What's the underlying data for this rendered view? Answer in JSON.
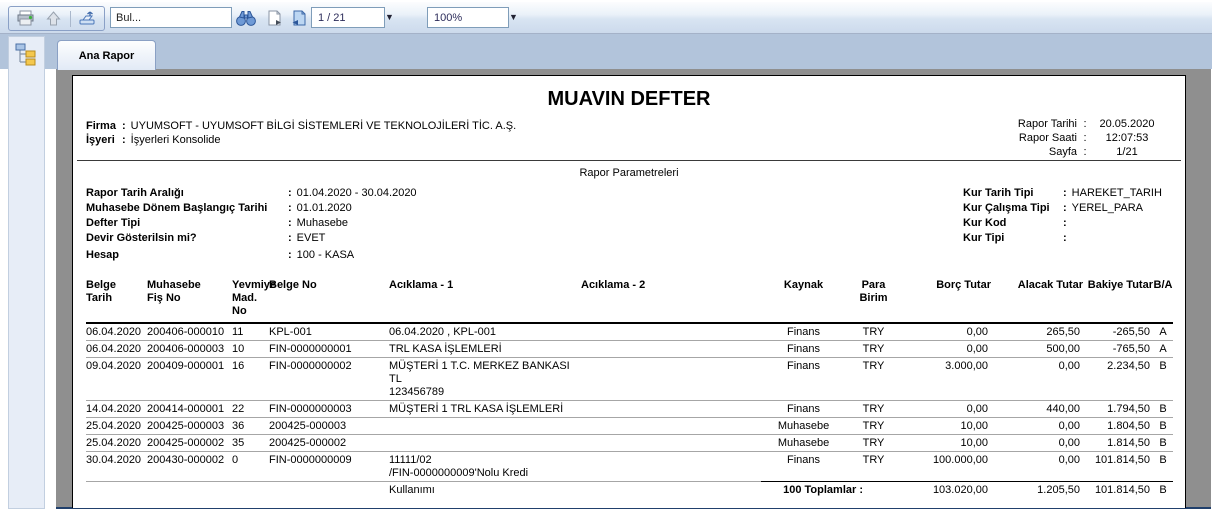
{
  "toolbar": {
    "find_value": "Bul...",
    "page_indicator": "1 / 21",
    "zoom_level": "100%",
    "dropdown_glyph": "▼"
  },
  "tabs": {
    "ana_rapor": "Ana Rapor"
  },
  "report": {
    "title": "MUAVIN DEFTER",
    "company": {
      "label": "Firma",
      "value": "UYUMSOFT - UYUMSOFT BİLGİ SİSTEMLERİ VE TEKNOLOJİLERİ TİC. A.Ş."
    },
    "branch": {
      "label": "İşyeri",
      "value": "İşyerleri Konsolide"
    },
    "info": [
      {
        "label": "Rapor Tarihi",
        "value": "20.05.2020"
      },
      {
        "label": "Rapor Saati",
        "value": "12:07:53"
      },
      {
        "label": "Sayfa",
        "value": "1/21"
      }
    ],
    "parameters_title": "Rapor Parametreleri",
    "parameters_left": [
      {
        "label": "Rapor Tarih Aralığı",
        "value": "01.04.2020 - 30.04.2020"
      },
      {
        "label": "Muhasebe Dönem Başlangıç Tarihi",
        "value": "01.01.2020"
      },
      {
        "label": "Defter Tipi",
        "value": "Muhasebe"
      },
      {
        "label": "Devir Gösterilsin mi?",
        "value": "EVET"
      },
      {
        "label": "Hesap",
        "value": "100 - KASA"
      }
    ],
    "parameters_right": [
      {
        "label": "Kur Tarih Tipi",
        "value": "HAREKET_TARIH"
      },
      {
        "label": "Kur Çalışma Tipi",
        "value": "YEREL_PARA"
      },
      {
        "label": "Kur Kod",
        "value": ""
      },
      {
        "label": "Kur Tipi",
        "value": ""
      }
    ],
    "table": {
      "headers": {
        "tarih": "Belge\nTarih",
        "fis": "Muhasebe\nFiş No",
        "mad": "Yevmiye\nMad. No",
        "belge": "Belge No",
        "a1": "Acıklama - 1",
        "a2": "Acıklama - 2",
        "kaynak": "Kaynak",
        "para": "Para\nBirim",
        "borc": "Borç Tutar",
        "alacak": "Alacak Tutar",
        "bakiye": "Bakiye Tutar",
        "ba": "B/A"
      },
      "rows": [
        {
          "tarih": "06.04.2020",
          "fis": "200406-000010",
          "mad": "11",
          "belge": "KPL-001",
          "a1": "06.04.2020 , KPL-001",
          "a2": "",
          "kaynak": "Finans",
          "para": "TRY",
          "borc": "0,00",
          "alacak": "265,50",
          "bakiye": "-265,50",
          "ba": "A"
        },
        {
          "tarih": "06.04.2020",
          "fis": "200406-000003",
          "mad": "10",
          "belge": "FIN-0000000001",
          "a1": "TRL KASA İŞLEMLERİ",
          "a2": "",
          "kaynak": "Finans",
          "para": "TRY",
          "borc": "0,00",
          "alacak": "500,00",
          "bakiye": "-765,50",
          "ba": "A"
        },
        {
          "tarih": "09.04.2020",
          "fis": "200409-000001",
          "mad": "16",
          "belge": "FIN-0000000002",
          "a1": "MÜŞTERİ 1 T.C. MERKEZ BANKASI TL\n123456789",
          "a2": "",
          "kaynak": "Finans",
          "para": "TRY",
          "borc": "3.000,00",
          "alacak": "0,00",
          "bakiye": "2.234,50",
          "ba": "B"
        },
        {
          "tarih": "14.04.2020",
          "fis": "200414-000001",
          "mad": "22",
          "belge": "FIN-0000000003",
          "a1": "MÜŞTERİ 1 TRL KASA İŞLEMLERİ",
          "a2": "",
          "kaynak": "Finans",
          "para": "TRY",
          "borc": "0,00",
          "alacak": "440,00",
          "bakiye": "1.794,50",
          "ba": "B"
        },
        {
          "tarih": "25.04.2020",
          "fis": "200425-000003",
          "mad": "36",
          "belge": "200425-000003",
          "a1": "",
          "a2": "",
          "kaynak": "Muhasebe",
          "para": "TRY",
          "borc": "10,00",
          "alacak": "0,00",
          "bakiye": "1.804,50",
          "ba": "B"
        },
        {
          "tarih": "25.04.2020",
          "fis": "200425-000002",
          "mad": "35",
          "belge": "200425-000002",
          "a1": "",
          "a2": "",
          "kaynak": "Muhasebe",
          "para": "TRY",
          "borc": "10,00",
          "alacak": "0,00",
          "bakiye": "1.814,50",
          "ba": "B"
        },
        {
          "tarih": "30.04.2020",
          "fis": "200430-000002",
          "mad": "0",
          "belge": "FIN-0000000009",
          "a1": "11111/02\n/FIN-0000000009'Nolu Kredi",
          "a2": "",
          "kaynak": "Finans",
          "para": "TRY",
          "borc": "100.000,00",
          "alacak": "0,00",
          "bakiye": "101.814,50",
          "ba": "B"
        }
      ],
      "totals": {
        "continuation": "Kullanımı",
        "label": "100 Toplamlar :",
        "borc": "103.020,00",
        "alacak": "1.205,50",
        "bakiye": "101.814,50",
        "ba": "B"
      }
    }
  }
}
